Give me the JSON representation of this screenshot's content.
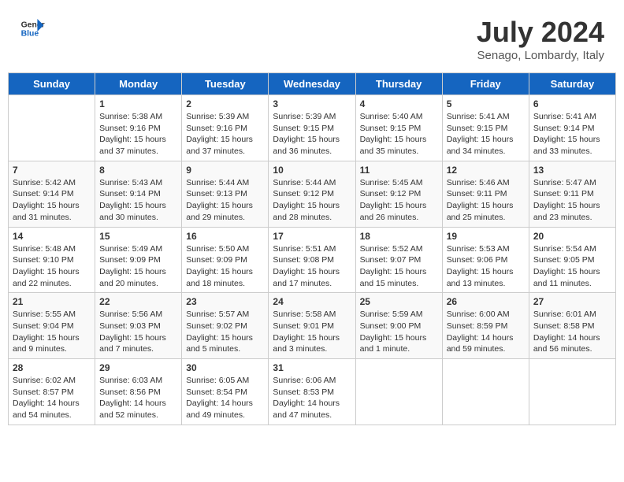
{
  "header": {
    "logo": {
      "line1": "General",
      "line2": "Blue"
    },
    "title": "July 2024",
    "location": "Senago, Lombardy, Italy"
  },
  "weekdays": [
    "Sunday",
    "Monday",
    "Tuesday",
    "Wednesday",
    "Thursday",
    "Friday",
    "Saturday"
  ],
  "weeks": [
    [
      {
        "day": "",
        "info": ""
      },
      {
        "day": "1",
        "info": "Sunrise: 5:38 AM\nSunset: 9:16 PM\nDaylight: 15 hours\nand 37 minutes."
      },
      {
        "day": "2",
        "info": "Sunrise: 5:39 AM\nSunset: 9:16 PM\nDaylight: 15 hours\nand 37 minutes."
      },
      {
        "day": "3",
        "info": "Sunrise: 5:39 AM\nSunset: 9:15 PM\nDaylight: 15 hours\nand 36 minutes."
      },
      {
        "day": "4",
        "info": "Sunrise: 5:40 AM\nSunset: 9:15 PM\nDaylight: 15 hours\nand 35 minutes."
      },
      {
        "day": "5",
        "info": "Sunrise: 5:41 AM\nSunset: 9:15 PM\nDaylight: 15 hours\nand 34 minutes."
      },
      {
        "day": "6",
        "info": "Sunrise: 5:41 AM\nSunset: 9:14 PM\nDaylight: 15 hours\nand 33 minutes."
      }
    ],
    [
      {
        "day": "7",
        "info": "Sunrise: 5:42 AM\nSunset: 9:14 PM\nDaylight: 15 hours\nand 31 minutes."
      },
      {
        "day": "8",
        "info": "Sunrise: 5:43 AM\nSunset: 9:14 PM\nDaylight: 15 hours\nand 30 minutes."
      },
      {
        "day": "9",
        "info": "Sunrise: 5:44 AM\nSunset: 9:13 PM\nDaylight: 15 hours\nand 29 minutes."
      },
      {
        "day": "10",
        "info": "Sunrise: 5:44 AM\nSunset: 9:12 PM\nDaylight: 15 hours\nand 28 minutes."
      },
      {
        "day": "11",
        "info": "Sunrise: 5:45 AM\nSunset: 9:12 PM\nDaylight: 15 hours\nand 26 minutes."
      },
      {
        "day": "12",
        "info": "Sunrise: 5:46 AM\nSunset: 9:11 PM\nDaylight: 15 hours\nand 25 minutes."
      },
      {
        "day": "13",
        "info": "Sunrise: 5:47 AM\nSunset: 9:11 PM\nDaylight: 15 hours\nand 23 minutes."
      }
    ],
    [
      {
        "day": "14",
        "info": "Sunrise: 5:48 AM\nSunset: 9:10 PM\nDaylight: 15 hours\nand 22 minutes."
      },
      {
        "day": "15",
        "info": "Sunrise: 5:49 AM\nSunset: 9:09 PM\nDaylight: 15 hours\nand 20 minutes."
      },
      {
        "day": "16",
        "info": "Sunrise: 5:50 AM\nSunset: 9:09 PM\nDaylight: 15 hours\nand 18 minutes."
      },
      {
        "day": "17",
        "info": "Sunrise: 5:51 AM\nSunset: 9:08 PM\nDaylight: 15 hours\nand 17 minutes."
      },
      {
        "day": "18",
        "info": "Sunrise: 5:52 AM\nSunset: 9:07 PM\nDaylight: 15 hours\nand 15 minutes."
      },
      {
        "day": "19",
        "info": "Sunrise: 5:53 AM\nSunset: 9:06 PM\nDaylight: 15 hours\nand 13 minutes."
      },
      {
        "day": "20",
        "info": "Sunrise: 5:54 AM\nSunset: 9:05 PM\nDaylight: 15 hours\nand 11 minutes."
      }
    ],
    [
      {
        "day": "21",
        "info": "Sunrise: 5:55 AM\nSunset: 9:04 PM\nDaylight: 15 hours\nand 9 minutes."
      },
      {
        "day": "22",
        "info": "Sunrise: 5:56 AM\nSunset: 9:03 PM\nDaylight: 15 hours\nand 7 minutes."
      },
      {
        "day": "23",
        "info": "Sunrise: 5:57 AM\nSunset: 9:02 PM\nDaylight: 15 hours\nand 5 minutes."
      },
      {
        "day": "24",
        "info": "Sunrise: 5:58 AM\nSunset: 9:01 PM\nDaylight: 15 hours\nand 3 minutes."
      },
      {
        "day": "25",
        "info": "Sunrise: 5:59 AM\nSunset: 9:00 PM\nDaylight: 15 hours\nand 1 minute."
      },
      {
        "day": "26",
        "info": "Sunrise: 6:00 AM\nSunset: 8:59 PM\nDaylight: 14 hours\nand 59 minutes."
      },
      {
        "day": "27",
        "info": "Sunrise: 6:01 AM\nSunset: 8:58 PM\nDaylight: 14 hours\nand 56 minutes."
      }
    ],
    [
      {
        "day": "28",
        "info": "Sunrise: 6:02 AM\nSunset: 8:57 PM\nDaylight: 14 hours\nand 54 minutes."
      },
      {
        "day": "29",
        "info": "Sunrise: 6:03 AM\nSunset: 8:56 PM\nDaylight: 14 hours\nand 52 minutes."
      },
      {
        "day": "30",
        "info": "Sunrise: 6:05 AM\nSunset: 8:54 PM\nDaylight: 14 hours\nand 49 minutes."
      },
      {
        "day": "31",
        "info": "Sunrise: 6:06 AM\nSunset: 8:53 PM\nDaylight: 14 hours\nand 47 minutes."
      },
      {
        "day": "",
        "info": ""
      },
      {
        "day": "",
        "info": ""
      },
      {
        "day": "",
        "info": ""
      }
    ]
  ]
}
